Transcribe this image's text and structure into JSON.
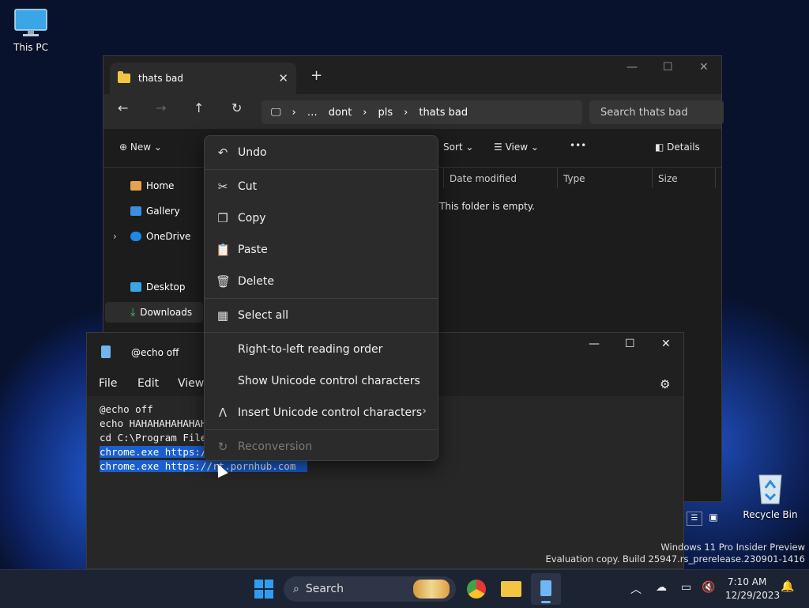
{
  "desktop": {
    "this_pc_label": "This PC",
    "recycle_bin_label": "Recycle Bin",
    "watermark_line1": "Windows 11 Pro Insider Preview",
    "watermark_line2": "Evaluation copy. Build 25947.rs_prerelease.230901-1416"
  },
  "explorer": {
    "tab_title": "thats bad",
    "new_tab": "+",
    "close_tab": "✕",
    "breadcrumb": [
      "…",
      "dont",
      "pls",
      "thats bad"
    ],
    "search_placeholder": "Search thats bad",
    "toolbar": {
      "new_label": "New",
      "sort_label": "Sort",
      "view_label": "View",
      "more_label": "•••",
      "details_label": "Details"
    },
    "nav_items": [
      "Home",
      "Gallery",
      "OneDrive",
      "Desktop",
      "Downloads"
    ],
    "columns": [
      "Date modified",
      "Type",
      "Size"
    ],
    "empty_message": "This folder is empty."
  },
  "notepad": {
    "title": "@echo off",
    "menu": [
      "File",
      "Edit",
      "View"
    ],
    "lines": [
      "@echo off",
      "echo HAHAHAHAHAHAHA",
      "cd C:\\Program Files",
      "chrome.exe https://",
      "chrome.exe https://rt.pornhub.com"
    ]
  },
  "context_menu": {
    "items": [
      {
        "label": "Undo",
        "icon": "undo-icon"
      },
      {
        "label": "Cut",
        "icon": "scissors-icon"
      },
      {
        "label": "Copy",
        "icon": "copy-icon"
      },
      {
        "label": "Paste",
        "icon": "paste-icon"
      },
      {
        "label": "Delete",
        "icon": "trash-icon"
      },
      {
        "label": "Select all",
        "icon": "select-all-icon"
      },
      {
        "label": "Right-to-left reading order",
        "icon": ""
      },
      {
        "label": "Show Unicode control characters",
        "icon": ""
      },
      {
        "label": "Insert Unicode control characters",
        "icon": "caret-icon"
      },
      {
        "label": "Reconversion",
        "icon": "reconversion-icon",
        "disabled": true
      }
    ]
  },
  "taskbar": {
    "search_label": "Search",
    "time": "7:10 AM",
    "date": "12/29/2023"
  },
  "colors": {
    "accent": "#1a5fd1",
    "window_bg": "#1c1c1c",
    "menu_bg": "#2b2b2b"
  }
}
